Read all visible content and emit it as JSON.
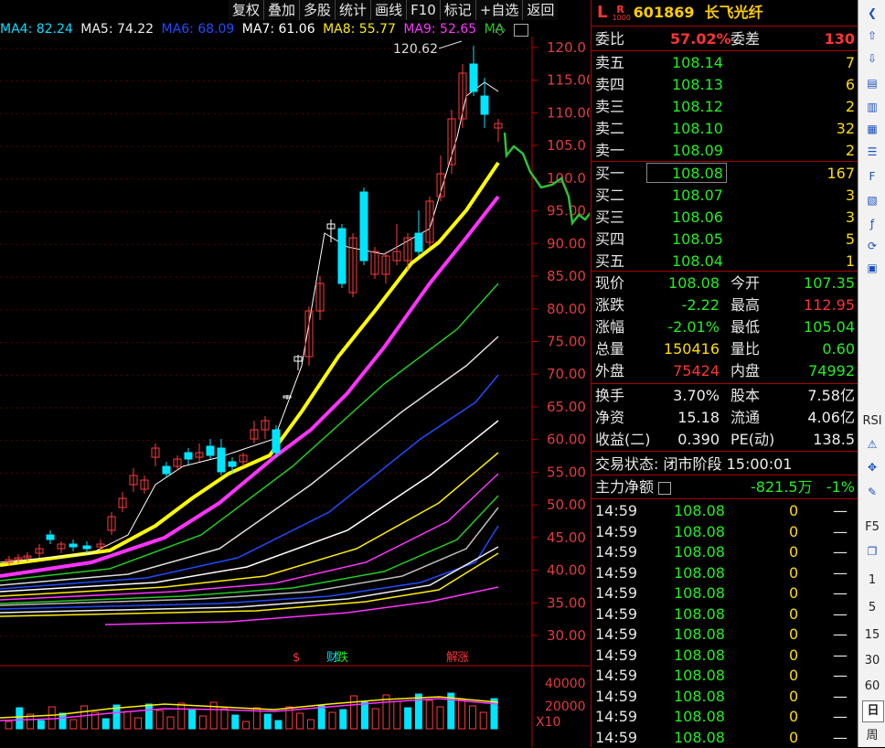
{
  "toolbar": [
    "复权",
    "叠加",
    "多股",
    "统计",
    "画线",
    "F10",
    "标记",
    "+自选",
    "返回"
  ],
  "ma_legend": [
    {
      "label": "MA4: 82.24",
      "color": "#00e0ff"
    },
    {
      "label": "MA5: 74.22",
      "color": "#eeeeee"
    },
    {
      "label": "MA6: 68.09",
      "color": "#1f4cff"
    },
    {
      "label": "MA7: 61.06",
      "color": "#ffffff"
    },
    {
      "label": "MA8: 55.77",
      "color": "#ffee00"
    },
    {
      "label": "MA9: 52.65",
      "color": "#ff33ff"
    },
    {
      "label": "MA",
      "color": "#22cc22"
    }
  ],
  "price_axis": [
    "120.0",
    "115.00",
    "110.00",
    "105.0",
    "100.0",
    "95.00",
    "90.00",
    "85.00",
    "80.00",
    "75.00",
    "70.00",
    "65.00",
    "60.00",
    "55.00",
    "50.00",
    "45.00",
    "40.00",
    "35.00",
    "30.00"
  ],
  "high_label": "120.62",
  "volume_axis": [
    "40000",
    "20000"
  ],
  "volume_unit": "X10",
  "markers": [
    "$",
    "财",
    "跌",
    "解",
    "涨"
  ],
  "stock": {
    "prefix": "L",
    "badge_top": "R",
    "badge_bottom": "1000",
    "code": "601869",
    "name": "长飞光纤"
  },
  "weibi": {
    "label1": "委比",
    "value1": "57.02%",
    "label2": "委差",
    "value2": "130"
  },
  "sell": [
    {
      "label": "卖五",
      "price": "108.14",
      "vol": "7"
    },
    {
      "label": "卖四",
      "price": "108.13",
      "vol": "6"
    },
    {
      "label": "卖三",
      "price": "108.12",
      "vol": "2"
    },
    {
      "label": "卖二",
      "price": "108.10",
      "vol": "32"
    },
    {
      "label": "卖一",
      "price": "108.09",
      "vol": "2"
    }
  ],
  "buy": [
    {
      "label": "买一",
      "price": "108.08",
      "vol": "167"
    },
    {
      "label": "买二",
      "price": "108.07",
      "vol": "3"
    },
    {
      "label": "买三",
      "price": "108.06",
      "vol": "3"
    },
    {
      "label": "买四",
      "price": "108.05",
      "vol": "5"
    },
    {
      "label": "买五",
      "price": "108.04",
      "vol": "1"
    }
  ],
  "quote": [
    {
      "l1": "现价",
      "v1": "108.08",
      "c1": "green",
      "l2": "今开",
      "v2": "107.35",
      "c2": "green"
    },
    {
      "l1": "涨跌",
      "v1": "-2.22",
      "c1": "green",
      "l2": "最高",
      "v2": "112.95",
      "c2": "red"
    },
    {
      "l1": "涨幅",
      "v1": "-2.01%",
      "c1": "green",
      "l2": "最低",
      "v2": "105.04",
      "c2": "green"
    },
    {
      "l1": "总量",
      "v1": "150416",
      "c1": "yellow",
      "l2": "量比",
      "v2": "0.60",
      "c2": "green"
    },
    {
      "l1": "外盘",
      "v1": "75424",
      "c1": "red",
      "l2": "内盘",
      "v2": "74992",
      "c2": "green"
    }
  ],
  "finance": [
    {
      "l1": "换手",
      "v1": "3.70%",
      "l2": "股本",
      "v2": "7.58亿"
    },
    {
      "l1": "净资",
      "v1": "15.18",
      "l2": "流通",
      "v2": "4.06亿"
    },
    {
      "l1": "收益(二)",
      "v1": "0.390",
      "l2": "PE(动)",
      "v2": "138.5"
    }
  ],
  "status": {
    "label": "交易状态:",
    "value": "闭市阶段 15:00:01"
  },
  "main_force": {
    "label": "主力净额",
    "value": "-821.5万",
    "pct": "-1%"
  },
  "ticks": [
    {
      "t": "14:59",
      "p": "108.08",
      "v": "0",
      "d": "—"
    },
    {
      "t": "14:59",
      "p": "108.08",
      "v": "0",
      "d": "—"
    },
    {
      "t": "14:59",
      "p": "108.08",
      "v": "0",
      "d": "—"
    },
    {
      "t": "14:59",
      "p": "108.08",
      "v": "0",
      "d": "—"
    },
    {
      "t": "14:59",
      "p": "108.08",
      "v": "0",
      "d": "—"
    },
    {
      "t": "14:59",
      "p": "108.08",
      "v": "0",
      "d": "—"
    },
    {
      "t": "14:59",
      "p": "108.08",
      "v": "0",
      "d": "—"
    },
    {
      "t": "14:59",
      "p": "108.08",
      "v": "0",
      "d": "—"
    },
    {
      "t": "14:59",
      "p": "108.08",
      "v": "0",
      "d": "—"
    },
    {
      "t": "14:59",
      "p": "108.08",
      "v": "0",
      "d": "—"
    },
    {
      "t": "14:59",
      "p": "108.08",
      "v": "0",
      "d": "—"
    },
    {
      "t": "14:59",
      "p": "108.08",
      "v": "0",
      "d": "—"
    }
  ],
  "side_icons": [
    "chevron-left-icon",
    "arrow-up-icon",
    "arrow-down-icon",
    "chart-icon",
    "kline-icon",
    "grid-icon",
    "list-icon",
    "f10-icon",
    "chart2-icon",
    "fx-icon",
    "refresh-icon",
    "red-box-icon",
    "rsi-icon",
    "alert-icon",
    "move-icon",
    "pencil-icon",
    "f5-icon",
    "copy-icon"
  ],
  "side_labels": [
    "RSI",
    "F5",
    "1",
    "5",
    "15",
    "30",
    "60",
    "日",
    "周"
  ]
}
